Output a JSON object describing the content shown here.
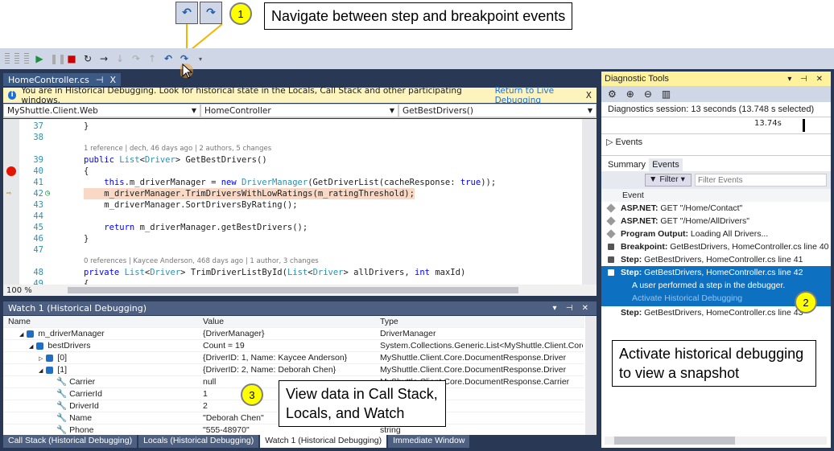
{
  "callouts": {
    "one": {
      "badge": "1",
      "text": "Navigate between step and breakpoint events"
    },
    "two": {
      "badge": "2",
      "text": "Activate historical debugging to view a snapshot"
    },
    "three": {
      "badge": "3",
      "text": "View data in Call Stack, Locals, and Watch"
    }
  },
  "nav_buttons": {
    "back": "↶",
    "forward": "↷"
  },
  "toolbar": {
    "icons": [
      "continue-icon",
      "pause-icon",
      "stop-icon",
      "restart-icon",
      "show-next-statement-icon",
      "step-into-icon",
      "step-over-icon",
      "step-out-icon",
      "step-back-icon",
      "step-forward-icon"
    ]
  },
  "editor": {
    "tab_label": "HomeController.cs",
    "tab_pin": "⊣",
    "tab_close": "X",
    "infobar": {
      "message": "You are in Historical Debugging. Look for historical state in the Locals, Call Stack and other participating windows.",
      "link": "Return to Live Debugging",
      "close": "X"
    },
    "nav": {
      "project": "MyShuttle.Client.Web",
      "class": "HomeController",
      "member": "GetBestDrivers()"
    },
    "zoom": "100 %",
    "lines": [
      {
        "n": "37",
        "text": "}"
      },
      {
        "n": "38",
        "text": ""
      },
      {
        "lens": "1 reference | dech, 46 days ago | 2 authors, 5 changes"
      },
      {
        "n": "39",
        "text": "public List<Driver> GetBestDrivers()"
      },
      {
        "n": "40",
        "text": "{"
      },
      {
        "n": "41",
        "text": "    this.m_driverManager = new DriverManager(GetDriverList(cacheResponse: true));"
      },
      {
        "n": "42",
        "text": "    m_driverManager.TrimDriversWithLowRatings(m_ratingThreshold);"
      },
      {
        "n": "43",
        "text": "    m_driverManager.SortDriversByRating();"
      },
      {
        "n": "44",
        "text": ""
      },
      {
        "n": "45",
        "text": "    return m_driverManager.getBestDrivers();"
      },
      {
        "n": "46",
        "text": "}"
      },
      {
        "n": "47",
        "text": ""
      },
      {
        "lens": "0 references | Kaycee Anderson, 468 days ago | 1 author, 3 changes"
      },
      {
        "n": "48",
        "text": "private List<Driver> TrimDriverListById(List<Driver> allDrivers, int maxId)"
      },
      {
        "n": "49",
        "text": "{"
      }
    ]
  },
  "watch": {
    "title": "Watch 1 (Historical Debugging)",
    "columns": [
      "Name",
      "Value",
      "Type"
    ],
    "rows": [
      {
        "name": "m_driverManager",
        "value": "{DriverManager}",
        "type": "DriverManager"
      },
      {
        "name": "bestDrivers",
        "value": "Count = 19",
        "type": "System.Collections.Generic.List<MyShuttle.Client.Core"
      },
      {
        "name": "[0]",
        "value": "{DriverID: 1, Name: Kaycee Anderson}",
        "type": "MyShuttle.Client.Core.DocumentResponse.Driver"
      },
      {
        "name": "[1]",
        "value": "{DriverID: 2, Name: Deborah Chen}",
        "type": "MyShuttle.Client.Core.DocumentResponse.Driver"
      },
      {
        "name": "Carrier",
        "value": "null",
        "type": "MyShuttle.Client.Core.DocumentResponse.Carrier"
      },
      {
        "name": "CarrierId",
        "value": "1",
        "type": ""
      },
      {
        "name": "DriverId",
        "value": "2",
        "type": ""
      },
      {
        "name": "Name",
        "value": "\"Deborah Chen\"",
        "type": ""
      },
      {
        "name": "Phone",
        "value": "\"555-48970\"",
        "type": "string"
      }
    ],
    "bottom_tabs": [
      "Call Stack (Historical Debugging)",
      "Locals (Historical Debugging)",
      "Watch 1 (Historical Debugging)",
      "Immediate Window"
    ]
  },
  "diagnostics": {
    "title": "Diagnostic Tools",
    "session": "Diagnostics session: 13 seconds (13.748 s selected)",
    "ruler_label": "13.74s",
    "events_section": "Events",
    "tabs": [
      "Summary",
      "Events"
    ],
    "filter_label": "Filter",
    "filter_placeholder": "Filter Events",
    "column": "Event",
    "events": [
      {
        "kind": "ASP.NET:",
        "text": " GET \"/Home/Contact\""
      },
      {
        "kind": "ASP.NET:",
        "text": " GET \"/Home/AllDrivers\""
      },
      {
        "kind": "Program Output:",
        "text": " Loading All Drivers..."
      },
      {
        "kind": "Breakpoint:",
        "text": " GetBestDrivers, HomeController.cs line 40"
      },
      {
        "kind": "Step:",
        "text": " GetBestDrivers, HomeController.cs line 41"
      },
      {
        "kind": "Step:",
        "text": " GetBestDrivers, HomeController.cs line 42"
      },
      {
        "kind": "Step:",
        "text": " GetBestDrivers, HomeController.cs line 43"
      }
    ],
    "selected_detail": "A user performed a step in the debugger.",
    "selected_link": "Activate Historical Debugging"
  }
}
